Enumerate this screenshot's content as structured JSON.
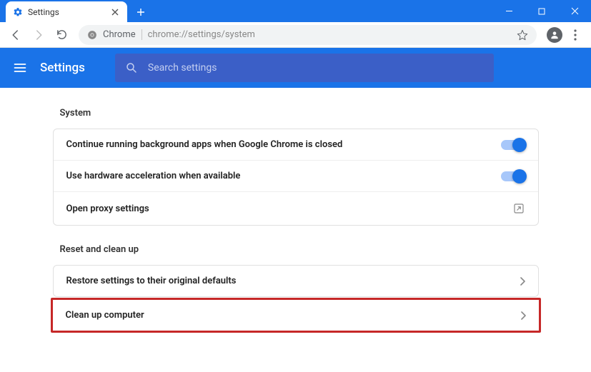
{
  "tab": {
    "title": "Settings"
  },
  "address": {
    "scheme_label": "Chrome",
    "url": "chrome://settings/system"
  },
  "header": {
    "title": "Settings",
    "search_placeholder": "Search settings"
  },
  "sections": {
    "system": {
      "title": "System",
      "rows": {
        "background_apps": {
          "label": "Continue running background apps when Google Chrome is closed",
          "toggle": true
        },
        "hw_accel": {
          "label": "Use hardware acceleration when available",
          "toggle": true
        },
        "proxy": {
          "label": "Open proxy settings"
        }
      }
    },
    "reset": {
      "title": "Reset and clean up",
      "rows": {
        "restore": {
          "label": "Restore settings to their original defaults"
        },
        "cleanup": {
          "label": "Clean up computer"
        }
      }
    }
  }
}
